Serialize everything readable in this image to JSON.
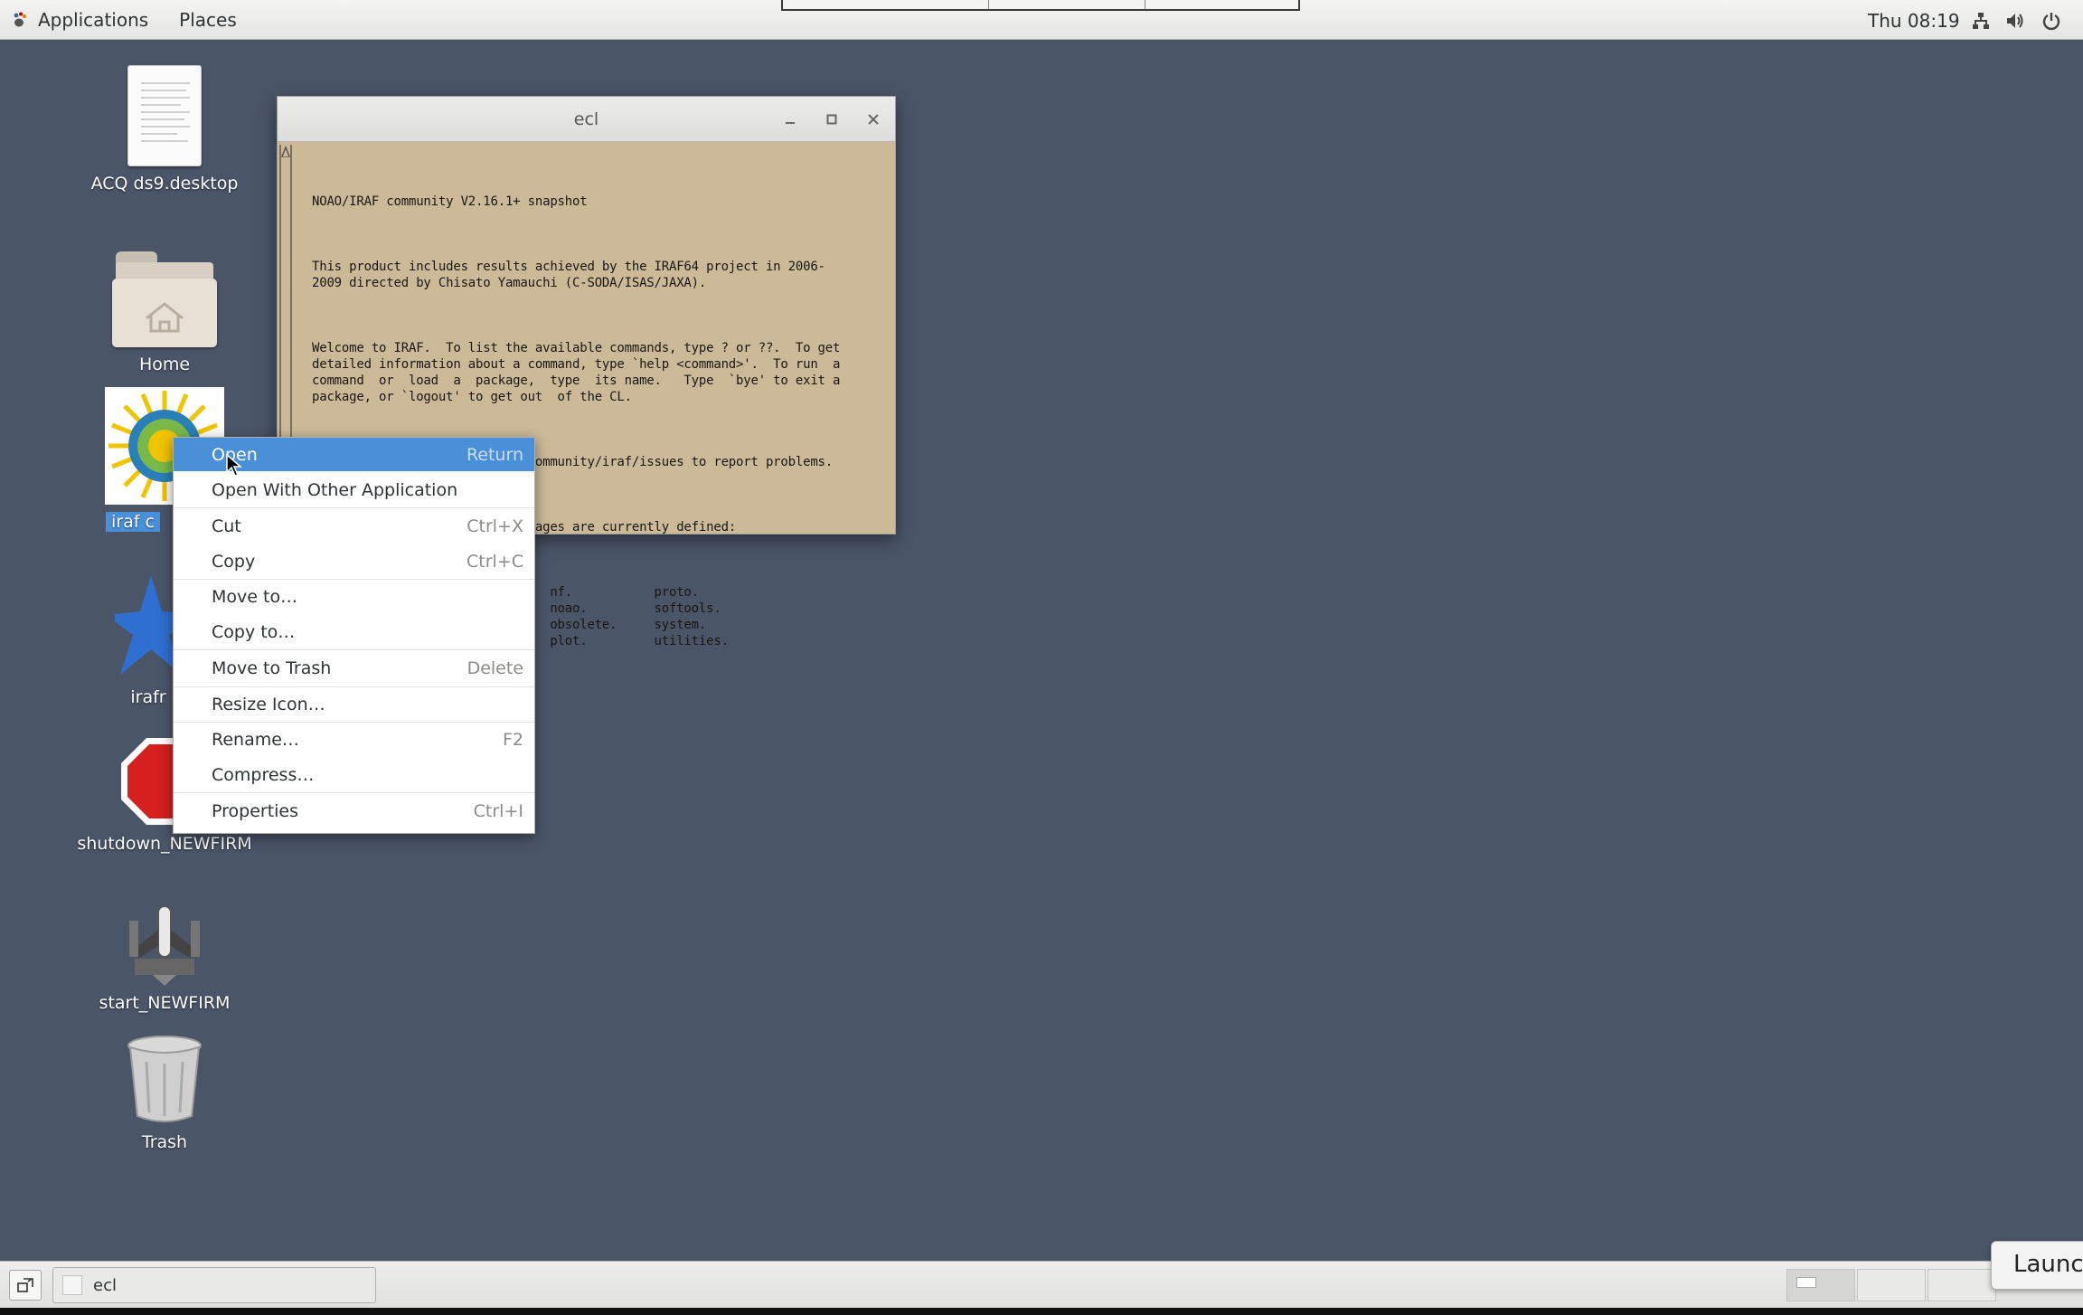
{
  "top_bar": {
    "applications_label": "Applications",
    "places_label": "Places",
    "clock": "Thu 08:19",
    "icons": [
      "network-icon",
      "volume-icon",
      "power-icon"
    ]
  },
  "desktop_icons": [
    {
      "label": "ACQ ds9.desktop",
      "icon": "document-icon"
    },
    {
      "label": "Home",
      "icon": "home-folder-icon"
    },
    {
      "label": "iraf c",
      "icon": "iraf-sun-icon",
      "selected": true
    },
    {
      "label": "irafr",
      "icon": "irafr-star-icon"
    },
    {
      "label": "shutdown_NEWFIRM",
      "icon": "stop-sign-icon"
    },
    {
      "label": "start_NEWFIRM",
      "icon": "rocket-icon"
    },
    {
      "label": "Trash",
      "icon": "trash-icon"
    }
  ],
  "ecl_window": {
    "title": "ecl",
    "lines": {
      "snapshot": "NOAO/IRAF community V2.16.1+ snapshot",
      "product": "This product includes results achieved by the IRAF64 project in 2006-\n2009 directed by Chisato Yamauchi (C-SODA/ISAS/JAXA).",
      "welcome": "Welcome to IRAF.  To list the available commands, type ? or ??.  To get\ndetailed information about a command, type `help <command>'.  To run  a\ncommand  or  load  a  package,  type  its name.   Type  `bye' to exit a\npackage, or `logout' to get out  of the CL.",
      "visit": "Visit http://github.com/iraf-community/iraf/issues to report problems.",
      "following": "The following commands or packages are currently defined:",
      "packages": "    arcview.      laboratory.   nf.           proto.\n    dataio.       language.     noao.         softools.\n    dbms.         lists.        obsolete.     system.\n                                plot.         utilities."
    }
  },
  "context_menu": {
    "items": [
      {
        "label": "Open",
        "accel": "Return",
        "active": true
      },
      {
        "label": "Open With Other Application",
        "accel": ""
      },
      {
        "label": "Cut",
        "accel": "Ctrl+X"
      },
      {
        "label": "Copy",
        "accel": "Ctrl+C"
      },
      {
        "label": "Move to…",
        "accel": ""
      },
      {
        "label": "Copy to…",
        "accel": ""
      },
      {
        "label": "Move to Trash",
        "accel": "Delete"
      },
      {
        "label": "Resize Icon…",
        "accel": ""
      },
      {
        "label": "Rename…",
        "accel": "F2"
      },
      {
        "label": "Compress…",
        "accel": ""
      },
      {
        "label": "Properties",
        "accel": "Ctrl+I"
      }
    ]
  },
  "bottom_bar": {
    "task_label": "ecl",
    "tooltip": "Launc"
  },
  "colors": {
    "desktop_bg": "#4a5568",
    "menu_highlight": "#4a90d9",
    "terminal_bg": "#cbb998"
  }
}
